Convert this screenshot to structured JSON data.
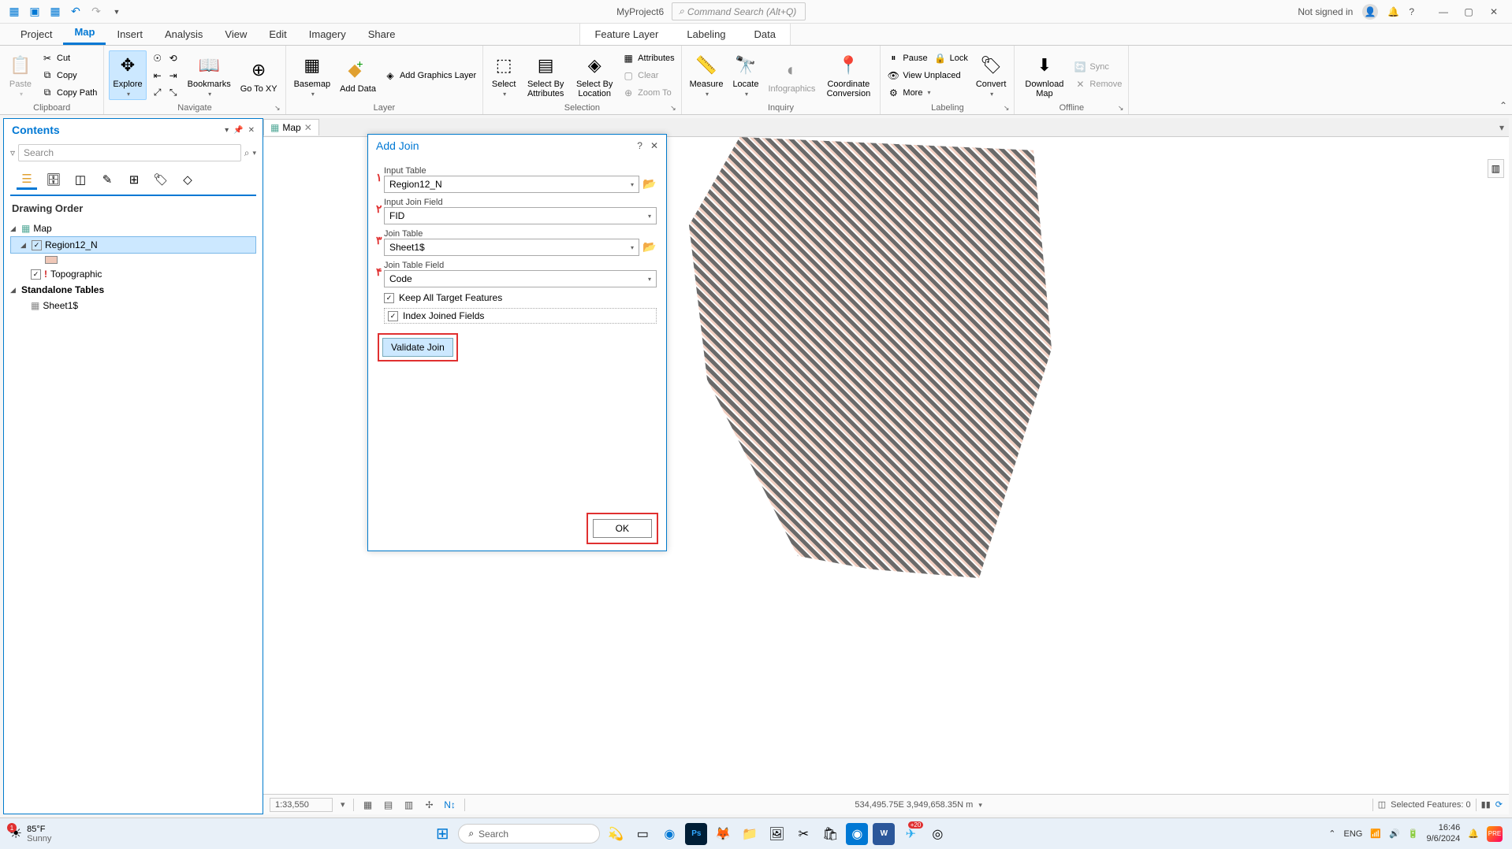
{
  "app": {
    "project_name": "MyProject6",
    "command_search_placeholder": "Command Search (Alt+Q)",
    "signin_text": "Not signed in"
  },
  "ribbon_tabs": {
    "project": "Project",
    "map": "Map",
    "insert": "Insert",
    "analysis": "Analysis",
    "view": "View",
    "edit": "Edit",
    "imagery": "Imagery",
    "share": "Share",
    "feature_layer": "Feature Layer",
    "labeling": "Labeling",
    "data": "Data"
  },
  "ribbon": {
    "clipboard": {
      "label": "Clipboard",
      "paste": "Paste",
      "cut": "Cut",
      "copy": "Copy",
      "copy_path": "Copy Path"
    },
    "navigate": {
      "label": "Navigate",
      "explore": "Explore",
      "bookmarks": "Bookmarks",
      "goto_xy": "Go To XY"
    },
    "layer": {
      "label": "Layer",
      "basemap": "Basemap",
      "add_data": "Add Data",
      "add_graphics": "Add Graphics Layer"
    },
    "selection": {
      "label": "Selection",
      "select": "Select",
      "select_by_attributes": "Select By Attributes",
      "select_by_location": "Select By Location",
      "attributes": "Attributes",
      "clear": "Clear",
      "zoom_to": "Zoom To"
    },
    "inquiry": {
      "label": "Inquiry",
      "measure": "Measure",
      "locate": "Locate",
      "infographics": "Infographics",
      "coord_conv": "Coordinate Conversion"
    },
    "labeling": {
      "label": "Labeling",
      "pause": "Pause",
      "lock": "Lock",
      "view_unplaced": "View Unplaced",
      "more": "More",
      "convert": "Convert"
    },
    "offline": {
      "label": "Offline",
      "download_map": "Download Map",
      "sync": "Sync",
      "remove": "Remove"
    }
  },
  "contents": {
    "title": "Contents",
    "search_placeholder": "Search",
    "drawing_order": "Drawing Order",
    "map": "Map",
    "layer_region": "Region12_N",
    "layer_topo": "Topographic",
    "standalone_tables": "Standalone Tables",
    "table_sheet1": "Sheet1$"
  },
  "map_view": {
    "tab_name": "Map",
    "scale": "1:33,550",
    "coords": "534,495.75E 3,949,658.35N m",
    "selected_features": "Selected Features: 0"
  },
  "dialog": {
    "title": "Add Join",
    "input_table_label": "Input Table",
    "input_table_value": "Region12_N",
    "input_join_field_label": "Input Join Field",
    "input_join_field_value": "FID",
    "join_table_label": "Join Table",
    "join_table_value": "Sheet1$",
    "join_table_field_label": "Join Table Field",
    "join_table_field_value": "Code",
    "keep_all": "Keep All Target Features",
    "index_joined": "Index Joined Fields",
    "validate": "Validate Join",
    "ok": "OK",
    "num1": "۱",
    "num2": "۲",
    "num3": "۳",
    "num4": "۴"
  },
  "taskbar": {
    "temp": "85°F",
    "weather": "Sunny",
    "search": "Search",
    "lang": "ENG",
    "time": "16:46",
    "date": "9/6/2024"
  }
}
